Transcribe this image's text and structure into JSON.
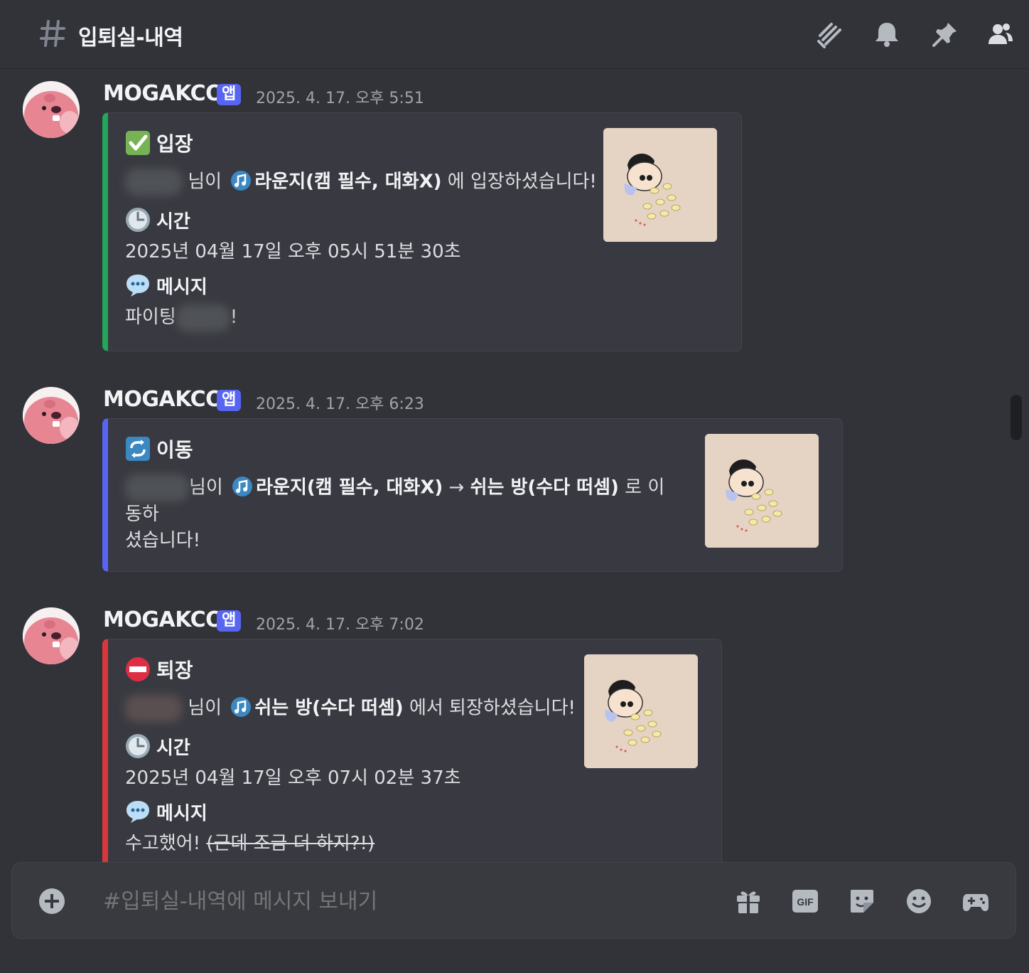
{
  "channel": {
    "name": "입퇴실-내역"
  },
  "messages": [
    {
      "author": "MOGAKCO",
      "badge": "앱",
      "timestamp": "2025. 4. 17. 오후 5:51",
      "embed": {
        "accent_color": "#23a55a",
        "title_icon": "check-mark-button-icon",
        "title": "입장",
        "desc_suffix": "님이",
        "channel_name": "라운지(캠 필수, 대화X)",
        "desc_end": "에 입장하셨습니다!",
        "fields": [
          {
            "icon": "clock-icon",
            "name": "시간",
            "value": "2025년 04월 17일 오후 05시 51분 30초"
          },
          {
            "icon": "speech-bubble-icon",
            "name": "메시지",
            "value": "파이팅",
            "value_suffix": "!"
          }
        ]
      }
    },
    {
      "author": "MOGAKCO",
      "badge": "앱",
      "timestamp": "2025. 4. 17. 오후 6:23",
      "embed": {
        "accent_color": "#5865f2",
        "title_icon": "repeat-arrows-icon",
        "title": "이동",
        "desc_suffix": "님이",
        "from_channel": "라운지(캠 필수, 대화X)",
        "arrow": "→",
        "to_channel": "쉬는 방(수다 떠셈)",
        "desc_end_line1": "로 이동하",
        "desc_end_line2": "셨습니다!"
      }
    },
    {
      "author": "MOGAKCO",
      "badge": "앱",
      "timestamp": "2025. 4. 17. 오후 7:02",
      "embed": {
        "accent_color": "#da373c",
        "title_icon": "no-entry-icon",
        "title": "퇴장",
        "desc_suffix": "님이",
        "channel_name": "쉬는 방(수다 떠셈)",
        "desc_end": "에서 퇴장하셨습니다!",
        "fields": [
          {
            "icon": "clock-icon",
            "name": "시간",
            "value": "2025년 04월 17일 오후 07시 02분 37초"
          },
          {
            "icon": "speech-bubble-icon",
            "name": "메시지",
            "value": "수고했어!",
            "value_strike": "(근데 조금 더 하지?!)"
          }
        ]
      }
    }
  ],
  "composer": {
    "placeholder": "#입퇴실-내역에 메시지 보내기",
    "gif_label": "GIF"
  },
  "icons": {
    "header": [
      "threads-icon",
      "bell-icon",
      "pin-icon",
      "members-icon"
    ],
    "composer": [
      "plus-icon",
      "gift-icon",
      "gif-icon",
      "sticker-icon",
      "emoji-icon",
      "apps-icon"
    ]
  }
}
